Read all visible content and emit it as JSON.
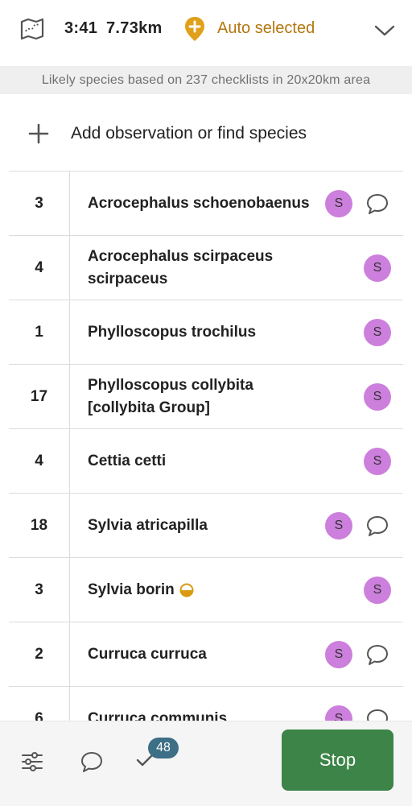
{
  "topbar": {
    "map_icon": "map-icon",
    "time": "3:41",
    "distance": "7.73km",
    "location_icon": "location-plus-icon",
    "location_label": "Auto selected",
    "location_color": "#b4760e",
    "expand_icon": "chevron-down-icon"
  },
  "subtitle": "Likely species based on 237 checklists in 20x20km area",
  "add_observation": {
    "icon": "plus-icon",
    "label": "Add observation or find species"
  },
  "species_list": [
    {
      "count": "3",
      "name": "Acrocephalus schoenobaenus",
      "badge": "S",
      "comment": true
    },
    {
      "count": "4",
      "name": "Acrocephalus scirpaceus scirpaceus",
      "badge": "S",
      "comment": false
    },
    {
      "count": "1",
      "name": "Phylloscopus trochilus",
      "badge": "S",
      "comment": false
    },
    {
      "count": "17",
      "name": "Phylloscopus collybita [collybita Group]",
      "badge": "S",
      "comment": false
    },
    {
      "count": "4",
      "name": "Cettia cetti",
      "badge": "S",
      "comment": false
    },
    {
      "count": "18",
      "name": "Sylvia atricapilla",
      "badge": "S",
      "comment": true
    },
    {
      "count": "3",
      "name": "Sylvia borin",
      "badge": "S",
      "comment": false,
      "marker_icon": "half-circle-icon"
    },
    {
      "count": "2",
      "name": "Curruca curruca",
      "badge": "S",
      "comment": true
    },
    {
      "count": "6",
      "name": "Curruca communis",
      "badge": "S",
      "comment": true
    }
  ],
  "badge_color": "#cc7fdc",
  "bottombar": {
    "filter_icon": "sliders-icon",
    "chat_icon": "comment-icon",
    "check_icon": "check-icon",
    "check_count": "48",
    "stop_label": "Stop",
    "stop_color": "#3c8447"
  }
}
